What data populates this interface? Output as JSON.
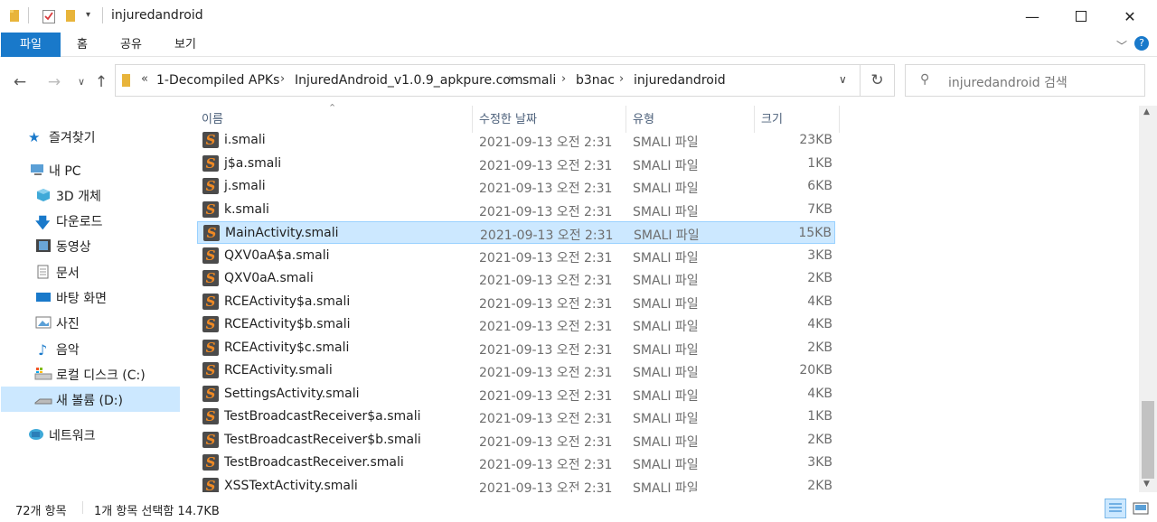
{
  "window": {
    "title": "injuredandroid"
  },
  "ribbon": {
    "tabs": [
      "파일",
      "홈",
      "공유",
      "보기"
    ]
  },
  "address": {
    "overflow": "«",
    "crumbs": [
      "1-Decompiled APKs",
      "InjuredAndroid_v1.0.9_apkpure.com",
      "smali",
      "b3nac",
      "injuredandroid"
    ]
  },
  "search": {
    "placeholder": "injuredandroid 검색"
  },
  "sidebar": {
    "items": [
      {
        "label": "즐겨찾기",
        "icon": "star-icon"
      },
      {
        "label": "내 PC",
        "icon": "pc-icon"
      },
      {
        "label": "3D 개체",
        "icon": "cube-icon"
      },
      {
        "label": "다운로드",
        "icon": "download-icon"
      },
      {
        "label": "동영상",
        "icon": "video-icon"
      },
      {
        "label": "문서",
        "icon": "document-icon"
      },
      {
        "label": "바탕 화면",
        "icon": "desktop-icon"
      },
      {
        "label": "사진",
        "icon": "picture-icon"
      },
      {
        "label": "음악",
        "icon": "music-icon"
      },
      {
        "label": "로컬 디스크 (C:)",
        "icon": "drive-icon"
      },
      {
        "label": "새 볼륨 (D:)",
        "icon": "drive-icon"
      },
      {
        "label": "네트워크",
        "icon": "network-icon"
      }
    ]
  },
  "columns": {
    "name": "이름",
    "date": "수정한 날짜",
    "type": "유형",
    "size": "크기"
  },
  "files": [
    {
      "name": "i.smali",
      "date": "2021-09-13 오전 2:31",
      "type": "SMALI 파일",
      "size": "23KB"
    },
    {
      "name": "j$a.smali",
      "date": "2021-09-13 오전 2:31",
      "type": "SMALI 파일",
      "size": "1KB"
    },
    {
      "name": "j.smali",
      "date": "2021-09-13 오전 2:31",
      "type": "SMALI 파일",
      "size": "6KB"
    },
    {
      "name": "k.smali",
      "date": "2021-09-13 오전 2:31",
      "type": "SMALI 파일",
      "size": "7KB"
    },
    {
      "name": "MainActivity.smali",
      "date": "2021-09-13 오전 2:31",
      "type": "SMALI 파일",
      "size": "15KB"
    },
    {
      "name": "QXV0aA$a.smali",
      "date": "2021-09-13 오전 2:31",
      "type": "SMALI 파일",
      "size": "3KB"
    },
    {
      "name": "QXV0aA.smali",
      "date": "2021-09-13 오전 2:31",
      "type": "SMALI 파일",
      "size": "2KB"
    },
    {
      "name": "RCEActivity$a.smali",
      "date": "2021-09-13 오전 2:31",
      "type": "SMALI 파일",
      "size": "4KB"
    },
    {
      "name": "RCEActivity$b.smali",
      "date": "2021-09-13 오전 2:31",
      "type": "SMALI 파일",
      "size": "4KB"
    },
    {
      "name": "RCEActivity$c.smali",
      "date": "2021-09-13 오전 2:31",
      "type": "SMALI 파일",
      "size": "2KB"
    },
    {
      "name": "RCEActivity.smali",
      "date": "2021-09-13 오전 2:31",
      "type": "SMALI 파일",
      "size": "20KB"
    },
    {
      "name": "SettingsActivity.smali",
      "date": "2021-09-13 오전 2:31",
      "type": "SMALI 파일",
      "size": "4KB"
    },
    {
      "name": "TestBroadcastReceiver$a.smali",
      "date": "2021-09-13 오전 2:31",
      "type": "SMALI 파일",
      "size": "1KB"
    },
    {
      "name": "TestBroadcastReceiver$b.smali",
      "date": "2021-09-13 오전 2:31",
      "type": "SMALI 파일",
      "size": "2KB"
    },
    {
      "name": "TestBroadcastReceiver.smali",
      "date": "2021-09-13 오전 2:31",
      "type": "SMALI 파일",
      "size": "3KB"
    },
    {
      "name": "XSSTextActivity.smali",
      "date": "2021-09-13 오전 2:31",
      "type": "SMALI 파일",
      "size": "2KB"
    }
  ],
  "selected_file": "MainActivity.smali",
  "status": {
    "count": "72개 항목",
    "selection": "1개 항목 선택함 14.7KB"
  },
  "colors": {
    "accent": "#1979ca",
    "selection": "#cce8ff",
    "selection_border": "#99d1ff"
  }
}
